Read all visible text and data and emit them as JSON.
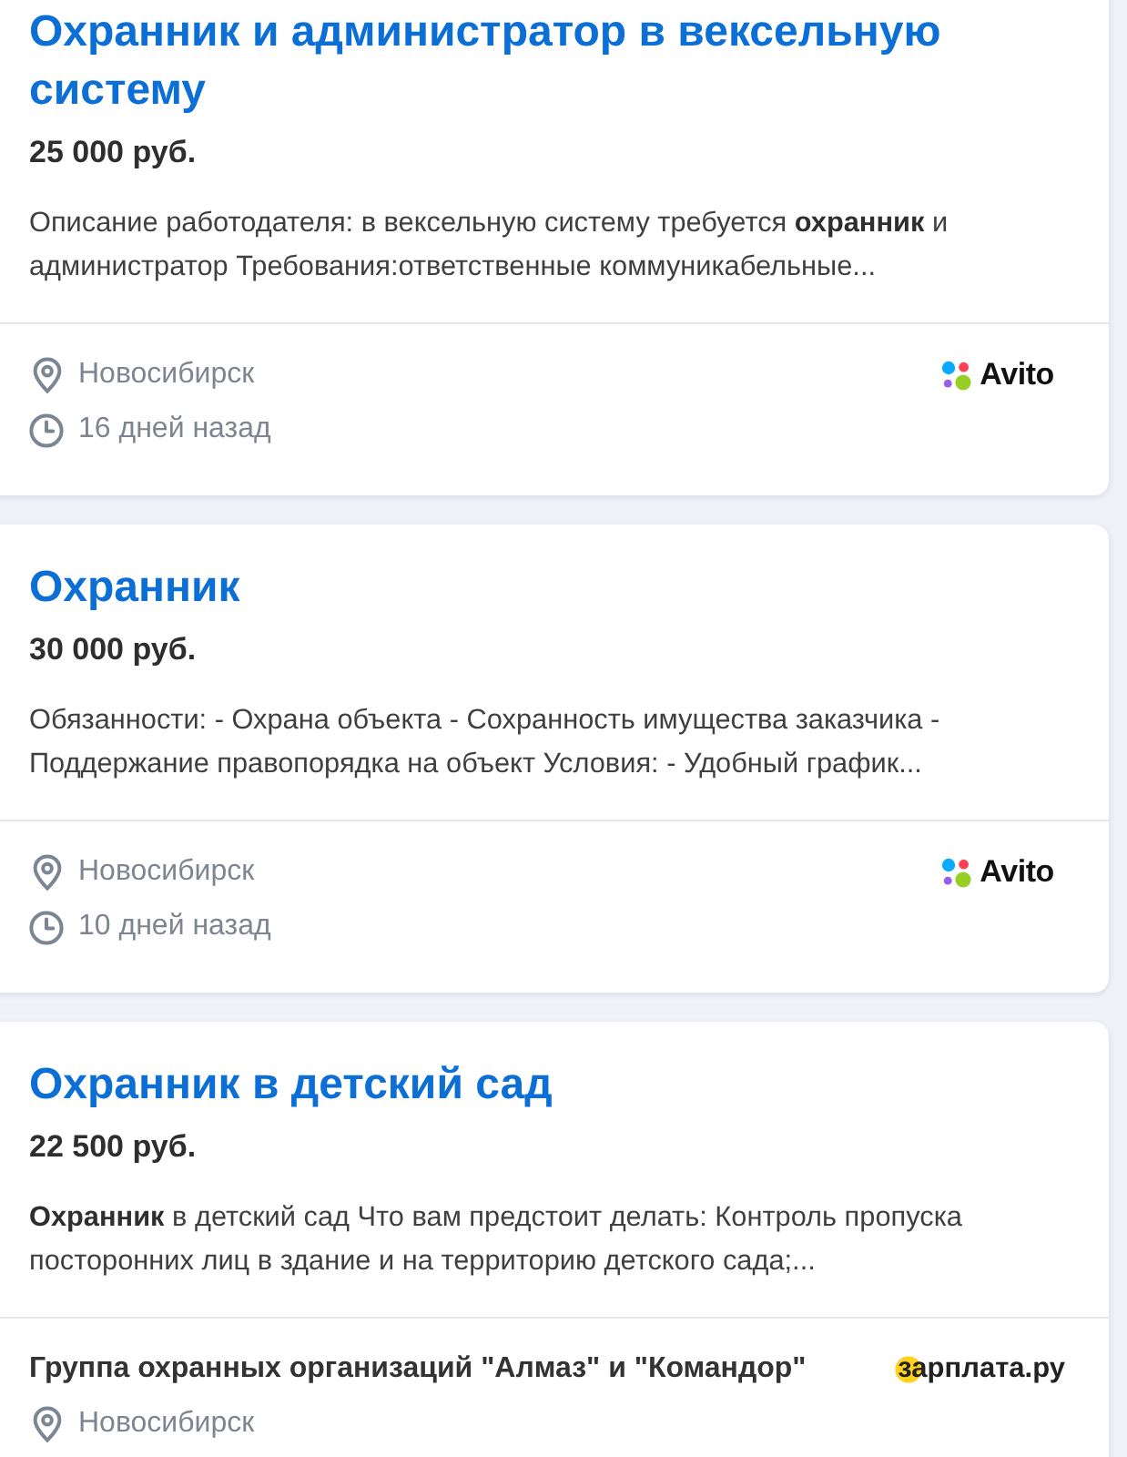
{
  "vacancies": [
    {
      "title": "Охранник и администратор в вексельную систему",
      "salary": "25 000 руб.",
      "description": "Описание работодателя: в вексельную систему требуется **охранник** и администратор Требования:ответственные коммуникабельные...",
      "location": "Новосибирск",
      "posted": "16 дней назад",
      "source": {
        "kind": "avito",
        "name": "Avito"
      }
    },
    {
      "title": "Охранник",
      "salary": "30 000 руб.",
      "description": "Обязанности: - Охрана объекта - Сохранность имущества заказчика - Поддержание правопорядка на объект Условия: - Удобный график...",
      "location": "Новосибирск",
      "posted": "10 дней назад",
      "source": {
        "kind": "avito",
        "name": "Avito"
      }
    },
    {
      "title": "Охранник в детский сад",
      "salary": "22 500 руб.",
      "description": "**Охранник** в детский сад Что вам предстоит делать: Контроль пропуска посторонних лиц в здание и на территорию детского сада;...",
      "employer": "Группа охранных организаций \"Алмаз\" и \"Командор\"",
      "location": "Новосибирск",
      "source": {
        "kind": "zarplata",
        "name": "зарплата.ру"
      }
    }
  ]
}
